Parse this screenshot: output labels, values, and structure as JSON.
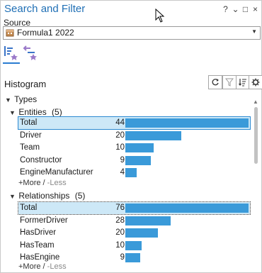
{
  "title": "Search and Filter",
  "titlebar": {
    "help": "?",
    "menu": "⌄",
    "minimize": "−",
    "maximize": "□",
    "close": "×"
  },
  "source": {
    "label": "Source",
    "value": "Formula1 2022"
  },
  "histogram": {
    "title": "Histogram"
  },
  "types": {
    "label": "Types"
  },
  "entities": {
    "label": "Entities",
    "count": "(5)",
    "rows": [
      {
        "label": "Total",
        "value": 44
      },
      {
        "label": "Driver",
        "value": 20
      },
      {
        "label": "Team",
        "value": 10
      },
      {
        "label": "Constructor",
        "value": 9
      },
      {
        "label": "EngineManufacturer",
        "value": 4
      }
    ],
    "more_label": "+More /",
    "less_label": " -Less"
  },
  "relationships": {
    "label": "Relationships",
    "count": "(5)",
    "rows": [
      {
        "label": "Total",
        "value": 76
      },
      {
        "label": "FormerDriver",
        "value": 28
      },
      {
        "label": "HasDriver",
        "value": 20
      },
      {
        "label": "HasTeam",
        "value": 10
      },
      {
        "label": "HasEngine",
        "value": 9
      }
    ],
    "more_label": "+More /",
    "less_label": " -Less"
  },
  "colors": {
    "accent": "#1f6fb5",
    "bar": "#3a9ad9",
    "selection": "#cde8f7"
  },
  "icons": [
    "database-icon",
    "chevron-down-icon",
    "entity-mode-icon",
    "relationship-mode-icon",
    "refresh-icon",
    "filter-icon",
    "sort-icon",
    "settings-icon"
  ]
}
